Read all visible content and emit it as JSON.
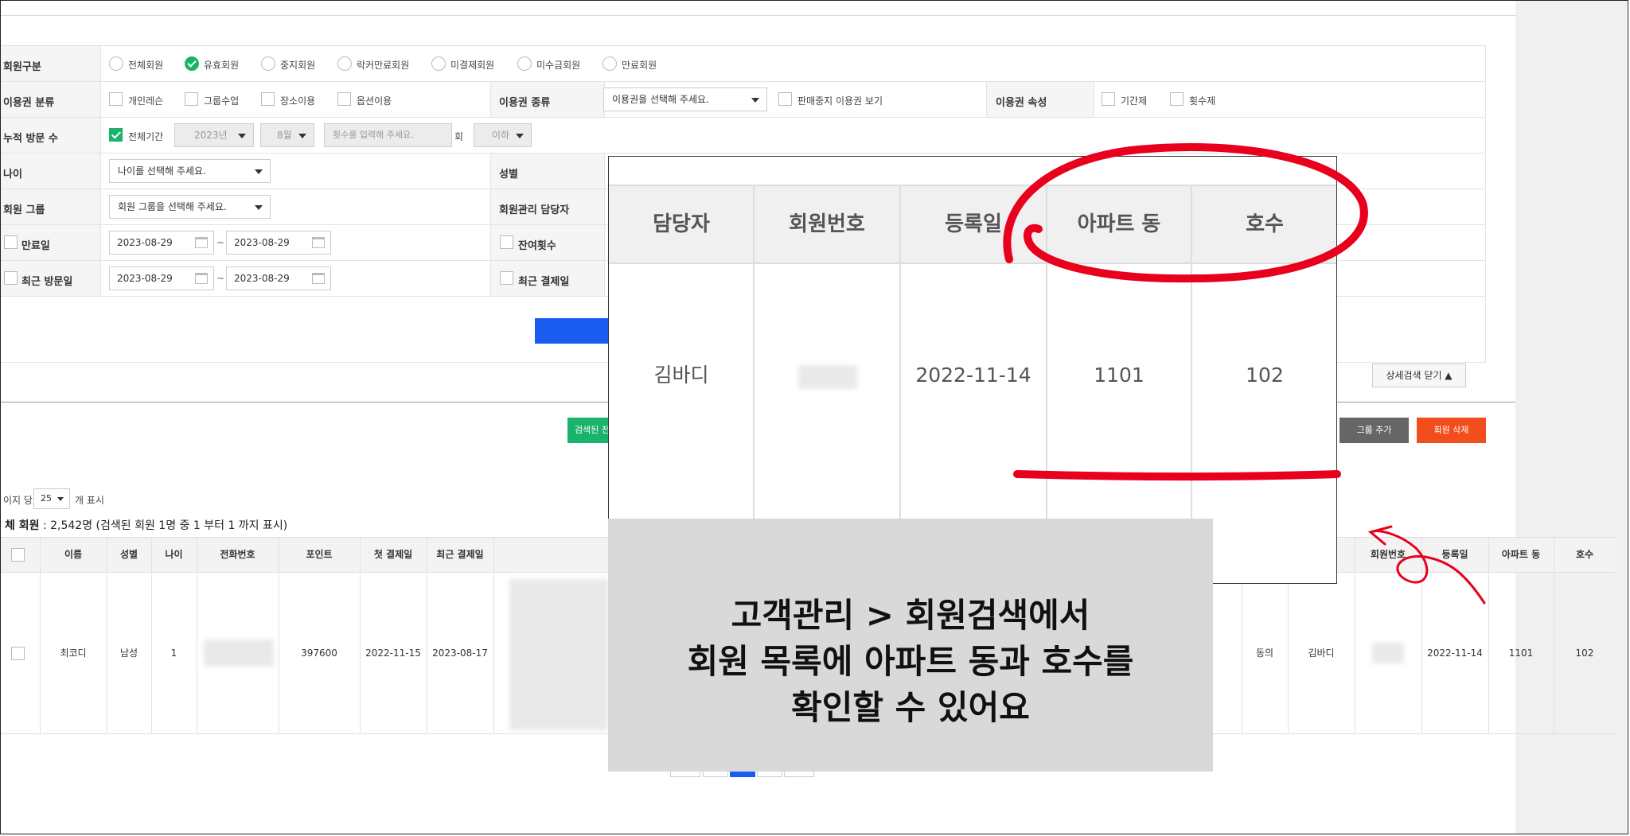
{
  "filters": {
    "member_type": {
      "label": "회원구분",
      "options": [
        "전체회원",
        "유효회원",
        "중지회원",
        "락커만료회원",
        "미결제회원",
        "미수금회원",
        "만료회원"
      ],
      "selected": "유효회원"
    },
    "ticket_category": {
      "label": "이용권 분류",
      "options": [
        "개인레슨",
        "그룹수업",
        "장소이용",
        "옵션이용"
      ]
    },
    "ticket_type": {
      "label": "이용권 종류",
      "placeholder": "이용권을 선택해 주세요.",
      "suspended_label": "판매중지 이용권 보기"
    },
    "ticket_attr": {
      "label": "이용권 속성",
      "options": [
        "기간제",
        "횟수제"
      ]
    },
    "visits": {
      "label": "누적 방문 수",
      "all_period": "전체기간",
      "year": "2023년",
      "month": "8월",
      "count_placeholder": "횟수를 입력해 주세요.",
      "unit": "회",
      "compare": "이하"
    },
    "age": {
      "label": "나이",
      "placeholder": "나이를 선택해 주세요."
    },
    "gender": {
      "label": "성별"
    },
    "group": {
      "label": "회원 그룹",
      "placeholder": "회원 그룹을 선택해 주세요."
    },
    "manager": {
      "label": "회원관리 담당자"
    },
    "expiry": {
      "label": "만료일",
      "from": "2023-08-29",
      "to": "2023-08-29"
    },
    "remaining": {
      "label": "잔여횟수"
    },
    "last_visit": {
      "label": "최근 방문일",
      "from": "2023-08-29",
      "to": "2023-08-29"
    },
    "last_payment": {
      "label": "최근 결제일"
    },
    "range_sep": "~"
  },
  "actions": {
    "detail_close": "상세검색 닫기 ▲",
    "searched_all": "검색된 전",
    "group_add": "그룹 추가",
    "member_delete": "회원 삭제"
  },
  "list": {
    "per_page_prefix": "이지 당",
    "per_page": "25",
    "per_page_suffix": "개 표시",
    "total_label": "체 회원",
    "total_text": ": 2,542명 (검색된 회원 1명 중 1 부터 1 까지 표시)",
    "columns": {
      "name": "이름",
      "gender": "성별",
      "age": "나이",
      "phone": "전화번호",
      "points": "포인트",
      "first_payment": "첫 결제일",
      "last_payment": "최근 결제일",
      "member_no": "회원번호",
      "registered": "등록일",
      "apt_dong": "아파트 동",
      "apt_ho": "호수"
    },
    "row": {
      "name": "최코디",
      "gender": "남성",
      "age": "1",
      "points": "397600",
      "first_payment": "2022-11-15",
      "last_payment": "2023-08-17",
      "consent": "동의",
      "manager": "김바디",
      "registered": "2022-11-14",
      "apt_dong": "1101",
      "apt_ho": "102"
    }
  },
  "zoom": {
    "headers": [
      "담당자",
      "회원번호",
      "등록일",
      "아파트 동",
      "호수"
    ],
    "values": [
      "김바디",
      "",
      "2022-11-14",
      "1101",
      "102"
    ]
  },
  "caption": {
    "line1": "고객관리 > 회원검색에서",
    "line2": "회원 목록에 아파트 동과 호수를",
    "line3": "확인할 수 있어요"
  },
  "colors": {
    "accent_green": "#19b36b",
    "search_blue": "#1a5cf0",
    "delete_orange": "#f24d1c",
    "annotation_red": "#e8001c"
  }
}
